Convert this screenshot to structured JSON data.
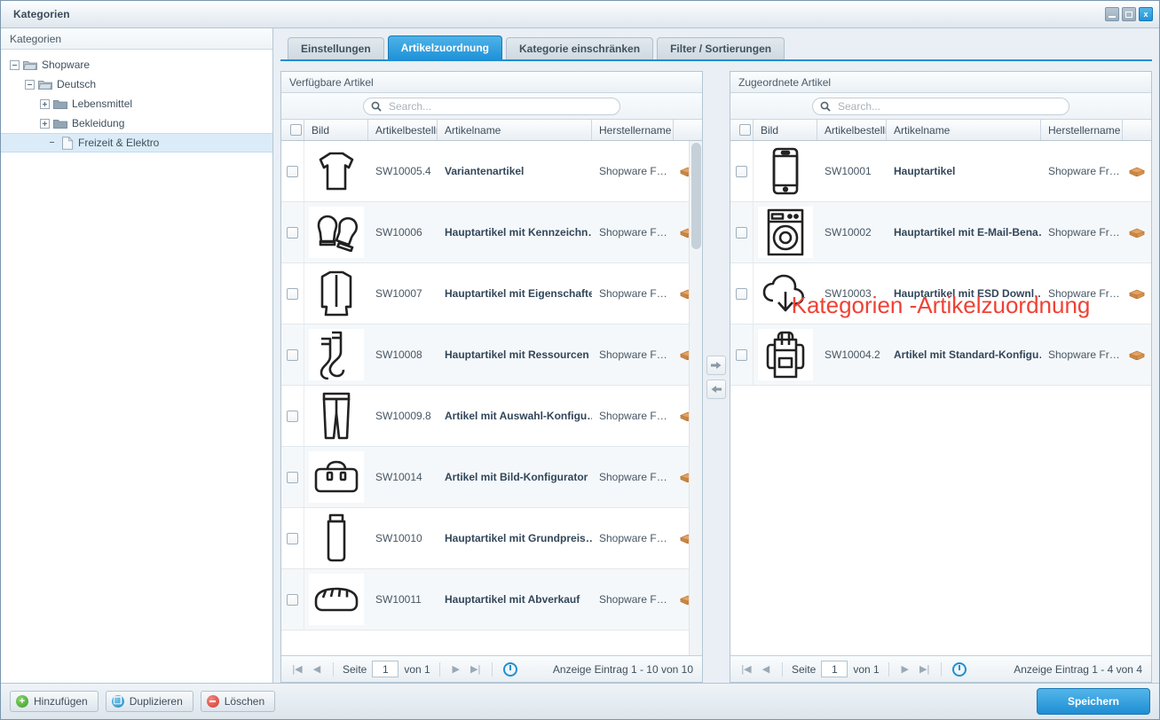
{
  "window": {
    "title": "Kategorien",
    "controls": [
      {
        "name": "minimize-button",
        "label": ""
      },
      {
        "name": "maximize-button",
        "label": ""
      },
      {
        "name": "close-button",
        "label": "x"
      }
    ]
  },
  "tree_panel": {
    "header": "Kategorien",
    "nodes": [
      {
        "label": "Shopware",
        "depth": 0,
        "state": "expanded",
        "icon": "folder-open-icon",
        "selected": false
      },
      {
        "label": "Deutsch",
        "depth": 1,
        "state": "expanded",
        "icon": "folder-open-icon",
        "selected": false
      },
      {
        "label": "Lebensmittel",
        "depth": 2,
        "state": "collapsed",
        "icon": "folder-icon",
        "selected": false
      },
      {
        "label": "Bekleidung",
        "depth": 2,
        "state": "collapsed",
        "icon": "folder-icon",
        "selected": false
      },
      {
        "label": "Freizeit & Elektro",
        "depth": 3,
        "state": "leaf",
        "icon": "document-icon",
        "selected": true
      }
    ]
  },
  "tabs": [
    {
      "label": "Einstellungen",
      "active": false
    },
    {
      "label": "Artikelzuordnung",
      "active": true
    },
    {
      "label": "Kategorie einschränken",
      "active": false
    },
    {
      "label": "Filter / Sortierungen",
      "active": false
    }
  ],
  "watermark": "Kategorien -Artikelzuordnung",
  "accent_color": "#1f8fd4",
  "watermark_color": "#ef4235",
  "columns": [
    "Bild",
    "Artikelbestellnun",
    "Artikelname",
    "Herstellername"
  ],
  "search_placeholder": "Search...",
  "left_grid": {
    "title": "Verfügbare Artikel",
    "search_value": "",
    "rows": [
      {
        "number": "SW10005.4",
        "name": "Variantenartikel",
        "manufacturer": "Shopware F…",
        "image": "sweater-icon",
        "package": "package-icon"
      },
      {
        "number": "SW10006",
        "name": "Hauptartikel mit Kennzeichn…",
        "manufacturer": "Shopware F…",
        "image": "mittens-icon",
        "package": "package-icon"
      },
      {
        "number": "SW10007",
        "name": "Hauptartikel mit Eigenschaften",
        "manufacturer": "Shopware F…",
        "image": "jacket-icon",
        "package": "package-icon"
      },
      {
        "number": "SW10008",
        "name": "Hauptartikel mit Ressourcen",
        "manufacturer": "Shopware F…",
        "image": "socks-icon",
        "package": "package-icon"
      },
      {
        "number": "SW10009.8",
        "name": "Artikel mit Auswahl-Konfigu…",
        "manufacturer": "Shopware F…",
        "image": "trousers-icon",
        "package": "package-icon"
      },
      {
        "number": "SW10014",
        "name": "Artikel mit Bild-Konfigurator",
        "manufacturer": "Shopware F…",
        "image": "bag-icon",
        "package": "package-icon"
      },
      {
        "number": "SW10010",
        "name": "Hauptartikel mit Grundpreis…",
        "manufacturer": "Shopware F…",
        "image": "tube-icon",
        "package": "package-icon"
      },
      {
        "number": "SW10011",
        "name": "Hauptartikel mit Abverkauf",
        "manufacturer": "Shopware F…",
        "image": "bread-icon",
        "package": "package-icon"
      }
    ],
    "pager": {
      "page_label": "Seite",
      "page_value": "1",
      "of_label": "von 1",
      "status": "Anzeige Eintrag 1 - 10 von 10"
    }
  },
  "right_grid": {
    "title": "Zugeordnete Artikel",
    "search_value": "",
    "rows": [
      {
        "number": "SW10001",
        "name": "Hauptartikel",
        "manufacturer": "Shopware Fr…",
        "image": "smartphone-icon",
        "package": "package-icon"
      },
      {
        "number": "SW10002",
        "name": "Hauptartikel mit E-Mail-Bena…",
        "manufacturer": "Shopware Fr…",
        "image": "washing-machine-icon",
        "package": "package-icon"
      },
      {
        "number": "SW10003",
        "name": "Hauptartikel mit ESD Downl…",
        "manufacturer": "Shopware Fr…",
        "image": "cloud-download-icon",
        "package": "package-icon"
      },
      {
        "number": "SW10004.2",
        "name": "Artikel mit Standard-Konfigu…",
        "manufacturer": "Shopware Fr…",
        "image": "backpack-icon",
        "package": "package-icon"
      }
    ],
    "pager": {
      "page_label": "Seite",
      "page_value": "1",
      "of_label": "von 1",
      "status": "Anzeige Eintrag 1 - 4 von 4"
    }
  },
  "transfer": {
    "assign_label": "➜",
    "unassign_label": "➜"
  },
  "bottom_toolbar": {
    "add_label": "Hinzufügen",
    "duplicate_label": "Duplizieren",
    "delete_label": "Löschen",
    "save_label": "Speichern"
  }
}
